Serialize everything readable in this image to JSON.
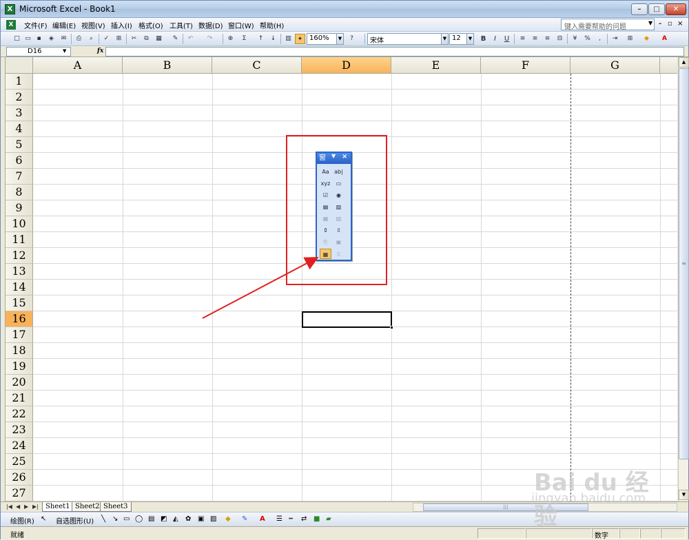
{
  "window": {
    "title": "Microsoft Excel - Book1",
    "app_icon_glyph": "X",
    "controls": [
      "–",
      "□",
      "✕"
    ]
  },
  "menu": {
    "items": [
      "文件(F)",
      "编辑(E)",
      "视图(V)",
      "插入(I)",
      "格式(O)",
      "工具(T)",
      "数据(D)",
      "窗口(W)",
      "帮助(H)"
    ],
    "help_placeholder": "键入需要帮助的问题",
    "doc_controls": [
      "-",
      "▫",
      "×"
    ]
  },
  "toolbar": {
    "zoom": "160%",
    "font_name": "宋体",
    "font_size": "12",
    "bold": "B",
    "italic": "I",
    "underline": "U",
    "percent": "%",
    "sum": "Σ"
  },
  "formula_bar": {
    "name_box": "D16",
    "fx": "fx"
  },
  "grid": {
    "columns": [
      "A",
      "B",
      "C",
      "D",
      "E",
      "F",
      "G"
    ],
    "rows": [
      "1",
      "2",
      "3",
      "4",
      "5",
      "6",
      "7",
      "8",
      "9",
      "10",
      "11",
      "12",
      "13",
      "14",
      "15",
      "16",
      "17",
      "18",
      "19",
      "20",
      "21",
      "22",
      "23",
      "24",
      "25",
      "26",
      "27"
    ],
    "selected_column": "D",
    "selected_row": "16"
  },
  "sheets": {
    "tabs": [
      "Sheet1",
      "Sheet2",
      "Sheet3"
    ],
    "active": "Sheet1"
  },
  "drawing_toolbar": {
    "draw_label": "绘图(R)",
    "autoshape_label": "自选图形(U)"
  },
  "status": {
    "ready": "就绪",
    "num": "数字"
  },
  "forms_toolbar": {
    "title": "窗",
    "tools": [
      [
        "Aa",
        "ab|"
      ],
      [
        "xyz",
        "▭"
      ],
      [
        "☑",
        "◉"
      ],
      [
        "▤",
        "▥"
      ],
      [
        "▦",
        "▧"
      ],
      [
        "⇕",
        "⇳"
      ],
      [
        "⎘",
        "▣"
      ],
      [
        "▦",
        "▯"
      ]
    ]
  },
  "watermark": {
    "logo": "Bai du 经验",
    "url": "jingyan.baidu.com"
  },
  "colors": {
    "selection": "#f8b35a",
    "annotation": "#e02020"
  }
}
